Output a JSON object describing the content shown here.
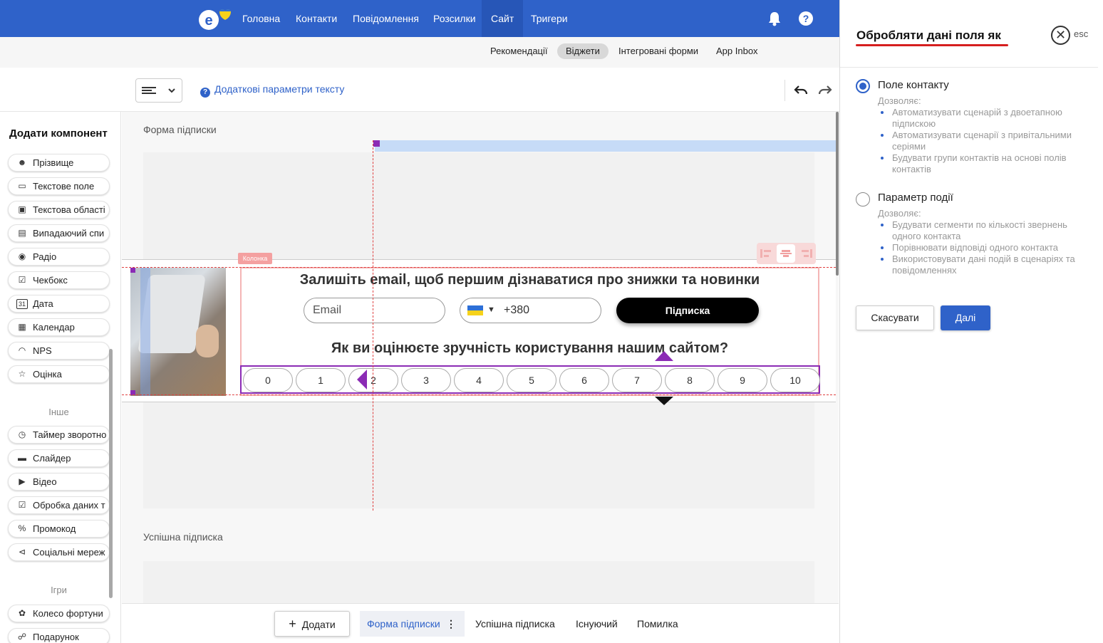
{
  "topnav": {
    "items": [
      "Головна",
      "Контакти",
      "Повідомлення",
      "Розсилки",
      "Сайт",
      "Тригери"
    ],
    "active": "Сайт"
  },
  "subnav": {
    "items": [
      "Рекомендації",
      "Віджети",
      "Інтегровані форми",
      "App Inbox"
    ],
    "active": "Віджети"
  },
  "toolbar": {
    "params_label": "Додаткові параметри тексту"
  },
  "sidebar": {
    "title": "Додати компонент",
    "components": [
      {
        "label": "Прізвище",
        "icon": "person-icon"
      },
      {
        "label": "Текстове поле",
        "icon": "text-field-icon"
      },
      {
        "label": "Текстова області",
        "icon": "textarea-icon"
      },
      {
        "label": "Випадаючий спи",
        "icon": "dropdown-icon"
      },
      {
        "label": "Радіо",
        "icon": "radio-icon"
      },
      {
        "label": "Чекбокс",
        "icon": "checkbox-icon"
      },
      {
        "label": "Дата",
        "icon": "date-icon"
      },
      {
        "label": "Календар",
        "icon": "calendar-icon"
      },
      {
        "label": "NPS",
        "icon": "gauge-icon"
      },
      {
        "label": "Оцінка",
        "icon": "star-icon"
      }
    ],
    "section_other": "Інше",
    "other": [
      {
        "label": "Таймер зворотно",
        "icon": "timer-icon"
      },
      {
        "label": "Слайдер",
        "icon": "slider-icon"
      },
      {
        "label": "Відео",
        "icon": "play-icon"
      },
      {
        "label": "Обробка даних т",
        "icon": "checkbox-icon"
      },
      {
        "label": "Промокод",
        "icon": "percent-icon"
      },
      {
        "label": "Соціальні мереж",
        "icon": "share-icon"
      }
    ],
    "section_games": "Ігри",
    "games": [
      {
        "label": "Колесо фортуни",
        "icon": "wheel-icon"
      },
      {
        "label": "Подарунок",
        "icon": "gift-icon"
      }
    ]
  },
  "canvas": {
    "section1_label": "Форма підписки",
    "section2_label": "Успішна підписка",
    "kolonka_tag": "Колонка",
    "headline": "Залишіть email, щоб першим дізнаватися про знижки та новинки",
    "email_placeholder": "Email",
    "phone_code": "+380",
    "subscribe_label": "Підписка",
    "question": "Як ви оцінюєте зручність користування нашим сайтом?",
    "nps_values": [
      "0",
      "1",
      "2",
      "3",
      "4",
      "5",
      "6",
      "7",
      "8",
      "9",
      "10"
    ]
  },
  "bottombar": {
    "add_label": "Додати",
    "tabs": [
      "Форма підписки",
      "Успішна підписка",
      "Існуючий",
      "Помилка"
    ],
    "active": "Форма підписки"
  },
  "rightpanel": {
    "title": "Обробляти дані поля як",
    "esc": "esc",
    "option1": {
      "label": "Поле контакту",
      "allows": "Дозволяє:",
      "bullets": [
        "Автоматизувати сценарій з двоетапною підпискою",
        "Автоматизувати сценарії з привітальними серіями",
        "Будувати групи контактів на основі полів контактів"
      ],
      "selected": true
    },
    "option2": {
      "label": "Параметр події",
      "allows": "Дозволяє:",
      "bullets": [
        "Будувати сегменти по кількості звернень одного контакта",
        "Порівнювати відповіді одного контакта",
        "Використовувати дані подій в сценаріях та повідомленнях"
      ],
      "selected": false
    },
    "cancel_label": "Скасувати",
    "next_label": "Далі"
  },
  "colors": {
    "brand": "#2f62c9",
    "nps_outline": "#8b2bb5",
    "alert_underline": "#d61f1f"
  }
}
